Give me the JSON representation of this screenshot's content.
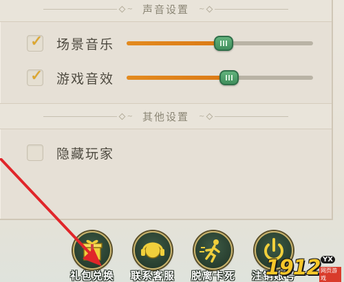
{
  "sections": {
    "sound_title": "声音设置",
    "other_title": "其他设置"
  },
  "settings": {
    "scene_music": {
      "label": "场景音乐",
      "checked": true,
      "level_percent": 52
    },
    "game_sfx": {
      "label": "游戏音效",
      "checked": true,
      "level_percent": 55
    },
    "hide_players": {
      "label": "隐藏玩家",
      "checked": false
    }
  },
  "bottom_buttons": [
    {
      "label": "礼包兑换",
      "icon": "gift-icon"
    },
    {
      "label": "联系客服",
      "icon": "headset-icon"
    },
    {
      "label": "脱离卡死",
      "icon": "running-man-icon"
    },
    {
      "label": "注销账号",
      "icon": "power-icon"
    }
  ],
  "watermark": {
    "number": "1912",
    "tag": "YX",
    "sub": "网页游戏"
  },
  "colors": {
    "accent_orange": "#e38a1f",
    "thumb_green": "#4a9a66",
    "check_gold": "#e0a82a"
  }
}
